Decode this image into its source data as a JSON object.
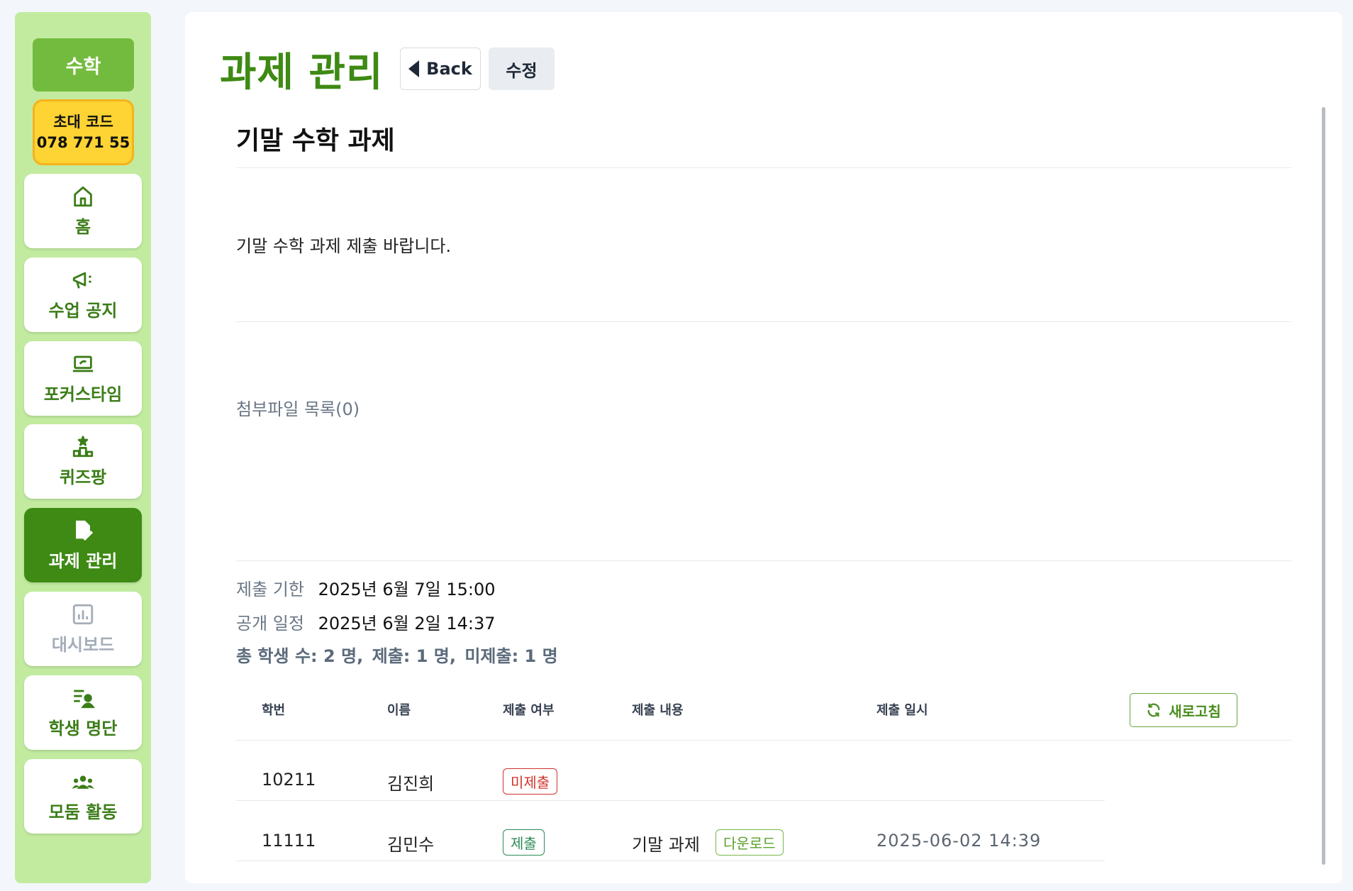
{
  "sidebar": {
    "subject": "수학",
    "invite": {
      "label": "초대 코드",
      "code": "078 771 55"
    },
    "items": [
      {
        "label": "홈",
        "icon": "home-icon"
      },
      {
        "label": "수업 공지",
        "icon": "megaphone-icon"
      },
      {
        "label": "포커스타임",
        "icon": "laptop-icon"
      },
      {
        "label": "퀴즈팡",
        "icon": "podium-icon"
      },
      {
        "label": "과제 관리",
        "icon": "file-edit-icon",
        "active": true
      },
      {
        "label": "대시보드",
        "icon": "bar-chart-icon",
        "disabled": true
      },
      {
        "label": "학생 명단",
        "icon": "student-list-icon"
      },
      {
        "label": "모둠 활동",
        "icon": "group-icon"
      }
    ]
  },
  "header": {
    "title": "과제 관리",
    "back_label": "Back",
    "edit_label": "수정"
  },
  "assignment": {
    "title": "기말 수학 과제",
    "description": "기말 수학 과제 제출 바랍니다.",
    "attachments_label": "첨부파일 목록(0)",
    "deadline_label": "제출 기한",
    "deadline_value": "2025년 6월 7일 15:00",
    "publish_label": "공개 일정",
    "publish_value": "2025년 6월 2일 14:37",
    "summary": {
      "total": "총 학생 수: 2 명,",
      "submitted": "제출: 1 명,",
      "not_submitted": "미제출: 1 명"
    }
  },
  "table": {
    "headers": [
      "학번",
      "이름",
      "제출 여부",
      "제출 내용",
      "제출 일시"
    ],
    "refresh_label": "새로고침",
    "rows": [
      {
        "id": "10211",
        "name": "김진희",
        "status": "미제출",
        "content": "",
        "download": "",
        "date": ""
      },
      {
        "id": "11111",
        "name": "김민수",
        "status": "제출",
        "content": "기말 과제",
        "download": "다운로드",
        "date": "2025-06-02 14:39"
      }
    ]
  },
  "colors": {
    "brand_green": "#3e8a14",
    "sidebar_bg": "#c2eba0",
    "invite_yellow": "#fdd433",
    "status_red": "#d0342c",
    "status_green": "#2e8b57"
  }
}
